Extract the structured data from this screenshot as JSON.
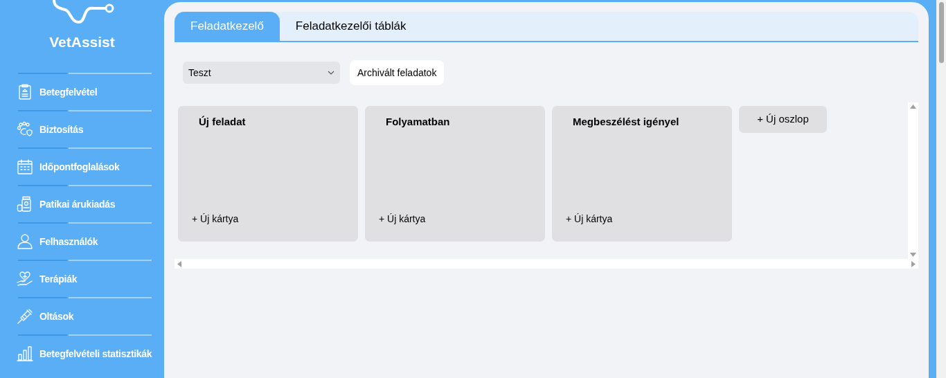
{
  "sidebar": {
    "app_name": "VetAssist",
    "items": [
      {
        "label": "Betegfelvétel",
        "kind": "clipboard"
      },
      {
        "label": "Biztosítás",
        "kind": "paw"
      },
      {
        "label": "Időpontfoglalások",
        "kind": "calendar"
      },
      {
        "label": "Patikai árukiadás",
        "kind": "jar"
      },
      {
        "label": "Felhasználók",
        "kind": "user"
      },
      {
        "label": "Terápiák",
        "kind": "heart"
      },
      {
        "label": "Oltások",
        "kind": "syringe"
      },
      {
        "label": "Betegfelvételi statisztikák",
        "kind": "chart"
      }
    ]
  },
  "tabs": [
    {
      "label": "Feladatkezelő",
      "selected": true
    },
    {
      "label": "Feladatkezelői táblák",
      "selected": false
    }
  ],
  "board_select": {
    "value": "Teszt"
  },
  "archived_button": "Archivált feladatok",
  "columns": [
    {
      "title": "Új feladat",
      "add_card": "+ Új kártya"
    },
    {
      "title": "Folyamatban",
      "add_card": "+ Új kártya"
    },
    {
      "title": "Megbeszélést igényel",
      "add_card": "+ Új kártya"
    }
  ],
  "add_column": "+ Új oszlop"
}
